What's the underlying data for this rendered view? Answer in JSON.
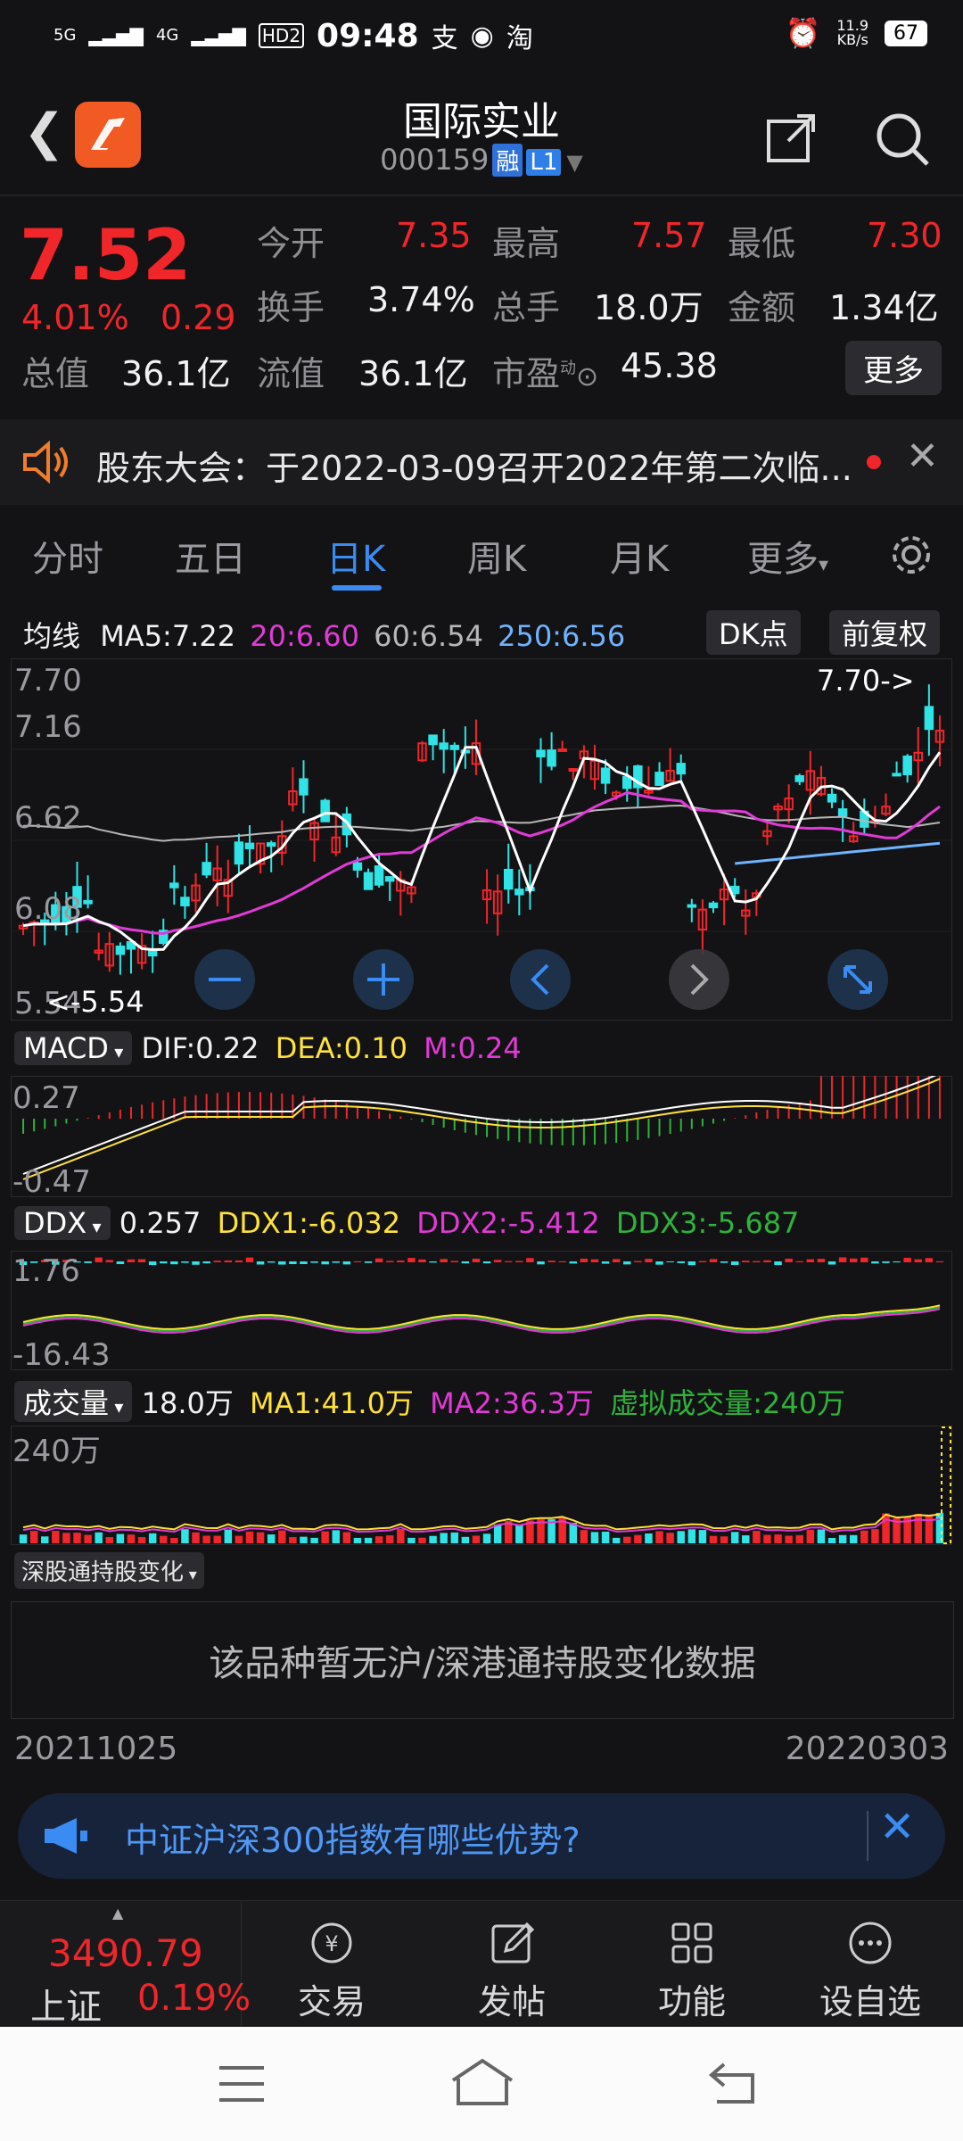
{
  "status_bar": {
    "signal_left": "5G",
    "signal_right": "4G",
    "hd": "HD2",
    "time": "09:48",
    "net_speed_value": "11.9",
    "net_speed_unit": "KB/s",
    "battery": "67"
  },
  "header": {
    "title": "国际实业",
    "code": "000159",
    "tag_margin": "融",
    "tag_level": "L1"
  },
  "quote": {
    "price": "7.52",
    "change_pct": "4.01%",
    "change": "0.29",
    "open_label": "今开",
    "open_value": "7.35",
    "high_label": "最高",
    "high_value": "7.57",
    "low_label": "最低",
    "low_value": "7.30",
    "turnover_label": "换手",
    "turnover_value": "3.74%",
    "volume_label": "总手",
    "volume_value": "18.0万",
    "amount_label": "金额",
    "amount_value": "1.34亿",
    "mktcap_label": "总值",
    "mktcap_value": "36.1亿",
    "float_label": "流值",
    "float_value": "36.1亿",
    "pe_label": "市盈",
    "pe_sup": "动",
    "pe_value": "45.38",
    "more_label": "更多"
  },
  "notice": {
    "text": "股东大会：于2022-03-09召开2022年第二次临..."
  },
  "tabs": [
    "分时",
    "五日",
    "日K",
    "周K",
    "月K",
    "更多"
  ],
  "active_tab": "日K",
  "kline": {
    "ma_label": "均线",
    "ma5": "MA5:7.22",
    "ma20": "20:6.60",
    "ma60": "60:6.54",
    "ma250": "250:6.56",
    "dk_label": "DK点",
    "adjust_label": "前复权",
    "y_ticks": [
      "7.70",
      "7.16",
      "6.62",
      "6.08",
      "5.54"
    ],
    "max_marker": "7.70->",
    "min_marker": "<-5.54"
  },
  "macd": {
    "selector": "MACD",
    "dif": "DIF:0.22",
    "dea": "DEA:0.10",
    "m": "M:0.24",
    "y_ticks": [
      "0.27",
      "-0.47"
    ]
  },
  "ddx": {
    "selector": "DDX",
    "value": "0.257",
    "ddx1": "DDX1:-6.032",
    "ddx2": "DDX2:-5.412",
    "ddx3": "DDX3:-5.687",
    "y_ticks": [
      "1.76",
      "-16.43"
    ]
  },
  "volume": {
    "selector": "成交量",
    "value": "18.0万",
    "ma1": "MA1:41.0万",
    "ma2": "MA2:36.3万",
    "virtual": "虚拟成交量:240万",
    "y_tick": "240万"
  },
  "hk": {
    "selector": "深股通持股变化",
    "empty_text": "该品种暂无沪/深港通持股变化数据"
  },
  "dates": {
    "start": "20211025",
    "end": "20220303"
  },
  "banner": {
    "text": "中证沪深300指数有哪些优势?"
  },
  "bottom": {
    "index_value": "3490.79",
    "index_name": "上证",
    "index_change": "0.19%",
    "items": [
      "交易",
      "发帖",
      "功能",
      "设自选"
    ]
  },
  "colors": {
    "up": "#f0262a",
    "down": "#2fe3e6",
    "ma5": "#ffffff",
    "ma20": "#e23ad6",
    "ma60": "#b7b7b7",
    "ma250": "#6fb3ff",
    "accent": "#3b8cf2"
  }
}
